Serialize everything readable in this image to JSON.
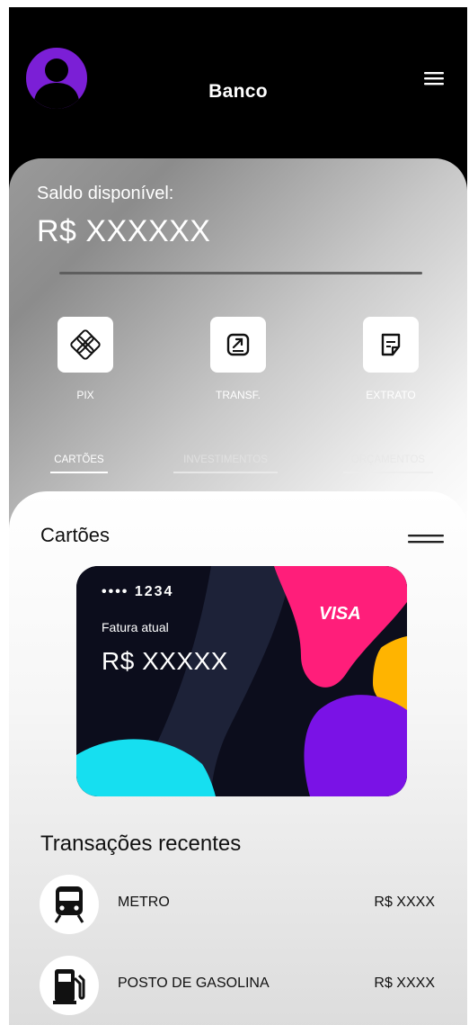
{
  "header": {
    "title": "Banco"
  },
  "balance": {
    "label": "Saldo disponível:",
    "value": "R$ XXXXXX"
  },
  "actions": [
    {
      "label": "PIX",
      "icon": "pix-icon"
    },
    {
      "label": "TRANSF.",
      "icon": "transfer-icon"
    },
    {
      "label": "EXTRATO",
      "icon": "statement-icon"
    }
  ],
  "tabs": [
    {
      "label": "CARTÕES",
      "active": true
    },
    {
      "label": "INVESTIMENTOS",
      "active": false
    },
    {
      "label": "ORÇAMENTOS",
      "active": false
    }
  ],
  "cards": {
    "title": "Cartões",
    "card": {
      "number": "•••• 1234",
      "brand": "VISA",
      "fatura_label": "Fatura atual",
      "amount": "R$ XXXXX"
    }
  },
  "transactions": {
    "title": "Transações recentes",
    "items": [
      {
        "name": "METRO",
        "amount": "R$ XXXX",
        "icon": "train-icon"
      },
      {
        "name": "POSTO DE GASOLINA",
        "amount": "R$ XXXX",
        "icon": "fuel-pump-icon"
      }
    ]
  },
  "colors": {
    "accent": "#7b1fd6",
    "card_pink": "#ff1e7a",
    "card_yellow": "#ffb400",
    "card_purple": "#7a12e6",
    "card_cyan": "#16dff0"
  }
}
